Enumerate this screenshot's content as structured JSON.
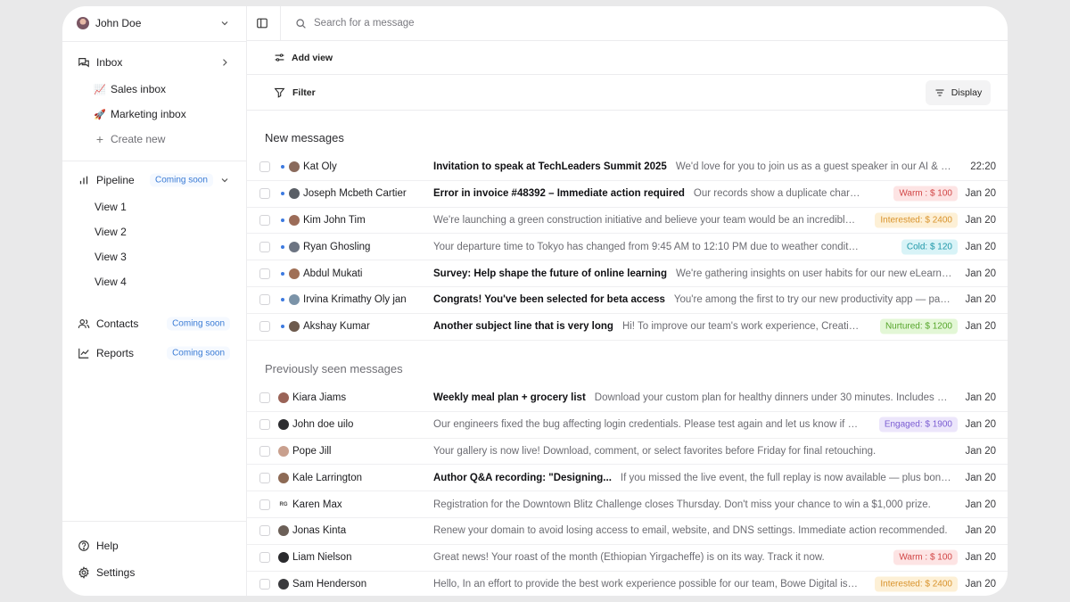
{
  "user": {
    "name": "John Doe"
  },
  "nav": {
    "inbox": "Inbox",
    "inbox_items": [
      {
        "emoji": "📈",
        "label": "Sales inbox"
      },
      {
        "emoji": "🚀",
        "label": "Marketing inbox"
      }
    ],
    "create_new": "Create new",
    "pipeline": "Pipeline",
    "pipeline_badge": "Coming soon",
    "views": [
      "View 1",
      "View 2",
      "View 3",
      "View 4"
    ],
    "contacts": "Contacts",
    "contacts_badge": "Coming soon",
    "reports": "Reports",
    "reports_badge": "Coming soon",
    "help": "Help",
    "settings": "Settings"
  },
  "search": {
    "placeholder": "Search for a message"
  },
  "toolbar": {
    "add_view": "Add view",
    "filter": "Filter",
    "display": "Display"
  },
  "sections": {
    "new_title": "New messages",
    "seen_title": "Previously seen messages"
  },
  "colors": {
    "warm_bg": "#fde4e4",
    "warm_fg": "#d14545",
    "interested_bg": "#fdf0d6",
    "interested_fg": "#d8922a",
    "cold_bg": "#d8f3f7",
    "cold_fg": "#1e97a8",
    "nurtured_bg": "#e3f7d6",
    "nurtured_fg": "#55a52a",
    "engaged_bg": "#ece6fb",
    "engaged_fg": "#7a5cd2",
    "unread_dot": "#3d7ae0",
    "coming_soon": "#3a7bd5"
  },
  "new_messages": [
    {
      "sender": "Kat Oly",
      "subject": "Invitation to speak at TechLeaders Summit 2025",
      "preview": "We'd love for you to join us as a guest speaker in our AI & Future Wo...",
      "tag": "",
      "tag_type": "",
      "date": "22:20",
      "avatar_color": "#8a6a5c"
    },
    {
      "sender": "Joseph Mcbeth Cartier",
      "subject": "Error in invoice #48392 – Immediate action required",
      "preview": "Our records show a duplicate charge in your la...",
      "tag": "Warm : $ 100",
      "tag_type": "warm",
      "date": "Jan 20",
      "avatar_color": "#5a5f66"
    },
    {
      "sender": "Kim John Tim",
      "subject": "",
      "preview": "We're launching a green construction initiative and believe your team would be an incredible strate...",
      "tag": "Interested: $ 2400",
      "tag_type": "interested",
      "date": "Jan 20",
      "avatar_color": "#9c6c58"
    },
    {
      "sender": "Ryan Ghosling",
      "subject": "",
      "preview": "Your departure time to Tokyo has changed from 9:45 AM to 12:10 PM due to weather conditions at LAX.",
      "tag": "Cold: $ 120",
      "tag_type": "cold",
      "date": "Jan 20",
      "avatar_color": "#6c7482"
    },
    {
      "sender": "Abdul Mukati",
      "subject": "Survey: Help shape the future of online learning",
      "preview": "We're gathering insights on user habits for our new eLearning platfo...",
      "tag": "",
      "tag_type": "",
      "date": "Jan 20",
      "avatar_color": "#a06f55"
    },
    {
      "sender": "Irvina Krimathy Oly jan",
      "subject": "Congrats! You've been selected for beta access",
      "preview": "You're among the first to try our new productivity app — packed wit...",
      "tag": "",
      "tag_type": "",
      "date": "Jan 20",
      "avatar_color": "#7b93a8"
    },
    {
      "sender": "Akshay Kumar",
      "subject": "Another subject line that is very long",
      "preview": "Hi! To improve our team's work experience, Creative Minds...",
      "tag": "Nurtured: $ 1200",
      "tag_type": "nurtured",
      "date": "Jan 20",
      "avatar_color": "#6d5a4d"
    }
  ],
  "seen_messages": [
    {
      "sender": "Kiara Jiams",
      "subject": "Weekly meal plan + grocery list",
      "preview": "Download your custom plan for healthy dinners under 30 minutes. Includes snacks a...",
      "tag": "",
      "tag_type": "",
      "date": "Jan 20",
      "avatar_color": "#9a6357",
      "avatar_text": ""
    },
    {
      "sender": "John doe uilo",
      "subject": "",
      "preview": "Our engineers fixed the bug affecting login credentials. Please test again and let us know if the issue...",
      "tag": "Engaged: $ 1900",
      "tag_type": "engaged",
      "date": "Jan 20",
      "avatar_color": "#2d2d30",
      "avatar_text": ""
    },
    {
      "sender": "Pope Jill",
      "subject": "",
      "preview": "Your gallery is now live! Download, comment, or select favorites before Friday for final retouching.",
      "tag": "",
      "tag_type": "",
      "date": "Jan 20",
      "avatar_color": "#c9a08e",
      "avatar_text": ""
    },
    {
      "sender": "Kale Larrington",
      "subject": "Author Q&A recording: \"Designing...",
      "preview": "If you missed the live event, the full replay is now available — plus bonus comm...",
      "tag": "",
      "tag_type": "",
      "date": "Jan 20",
      "avatar_color": "#8d6a55",
      "avatar_text": ""
    },
    {
      "sender": "Karen Max",
      "subject": "",
      "preview": "Registration for the Downtown Blitz Challenge closes Thursday. Don't miss your chance to win a $1,000 prize.",
      "tag": "",
      "tag_type": "",
      "date": "Jan 20",
      "avatar_color": "#ffffff",
      "avatar_text": "RG"
    },
    {
      "sender": "Jonas Kinta",
      "subject": "",
      "preview": "Renew your domain to avoid losing access to email, website, and DNS settings. Immediate action recommended.",
      "tag": "",
      "tag_type": "",
      "date": "Jan 20",
      "avatar_color": "#6b5f57",
      "avatar_text": ""
    },
    {
      "sender": "Liam Nielson",
      "subject": "",
      "preview": "Great news! Your roast of the month (Ethiopian Yirgacheffe) is on its way. Track it now.",
      "tag": "Warm : $ 100",
      "tag_type": "warm",
      "date": "Jan 20",
      "avatar_color": "#2a2a2d",
      "avatar_text": ""
    },
    {
      "sender": "Sam Henderson",
      "subject": "",
      "preview": "Hello, In an effort to provide the best work experience possible for our team, Bowe Digital is closed o...",
      "tag": "Interested: $ 2400",
      "tag_type": "interested",
      "date": "Jan 20",
      "avatar_color": "#3a3a3d",
      "avatar_text": ""
    }
  ]
}
